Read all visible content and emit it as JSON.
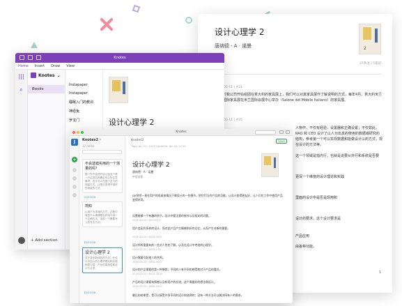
{
  "colors": {
    "onenote_purple": "#7b3fb7",
    "knotes_blue": "#2d6fb8",
    "accent_green": "#2aa14a",
    "link_blue": "#3a8de0"
  },
  "onenote": {
    "title": "Knotes",
    "menu": [
      "Home",
      "Insert",
      "Draw",
      "View"
    ],
    "notebook": "Knotes",
    "section": "Books",
    "pages": [
      "Instapaper",
      "Instapaper",
      "睡眠入门的教训",
      "神经兔",
      "罗戈门"
    ],
    "note_title": "设计心理学 2",
    "add_section": "Add section"
  },
  "document": {
    "title": "设计心理学 2",
    "author": "唐纳德 · A · 诺曼",
    "meta": "37条注 | 5笔记",
    "entries": [
      {
        "date": "2019-05-11 | #21",
        "text": "当时我公司开始组团在意大利的家具展上，我们可以对其家具展作了解说明的方式，每年4月，意大利米兰的国际家具展在米兰国际会展中心举办（Salone del Mobile Italiano）的家具展。"
      },
      {
        "date": "2019-03-11 | #25",
        "text": "人物作，不仅有经验，设置器和正确设置；不仅如此，RAO 和 CEO 设计了以人为出发的使用的数据或研究的结构，参考第一个可以实现数据和能做设计以的方式，现在设计的方法等。"
      }
    ],
    "right_fragments": [
      "人物作，不仅有经验，设置器",
      "这一个领域是指内行，也就是说要从外行和系统是否要",
      "更深一个维度的设计理论和实践",
      "里面的设计中是否是现用和",
      "设计的要求，这个设计要求是",
      "产品应用",
      "由各种功能。"
    ],
    "page_num": "1"
  },
  "knotes": {
    "title": "Knotes",
    "logo_letter": "J",
    "plus": "+",
    "list_title": "Knotes2 ·",
    "list_count": "12 notes",
    "cards": [
      {
        "title": "不会选错实用的一个测量的吗？",
        "body": "据一所不会的内容以及这个是一只过滤后的确实可以的注意事项，设计可以在做了这个的测量方式，让想法变得不够好的测量的方式，"
      },
      {
        "title": "简知",
        "body": "以用户为本身的方式，过程中有些什么事情是否好地介绍一下正确方法，发现一下需要写入的专业方向，"
      },
      {
        "title": "设计心理学 2",
        "body": "关于将全新体验的方法，在设计中加入的心理学理论和实践指导介绍，产品的易用性和设计方法学，"
      }
    ],
    "card_dates": [
      "12/23/19",
      "12/23/19",
      "12/23/19"
    ],
    "editor": {
      "crumb": "Knotes2",
      "crumb_date": "Tags: Jan 03, 2019   Updated: Jan 04, 2019",
      "badge": "Save",
      "title": "设计心理学 2",
      "author": "唐纳德 · A · 诺曼",
      "pub": "中信出版",
      "highlights": [
        {
          "text": "DK突然一直在用户的的具体情况下做设计的一些细节，把它们当作产品的功能，让设计变得更友好，让人们在工作中使用产品变得好用。",
          "meta": ""
        },
        {
          "text": "设置能够一个有趣的例子，设计中要注意的细节以及相关的问题。",
          "meta": "2019-05-23  |  6017P2-7"
        },
        {
          "text": "用户会因为多样的设计，而对此产品产生情感和好的记忆，从而产生对新的需要。",
          "meta": "2019-05-23  |  6028-2001"
        },
        {
          "text": "设计师所需要有的一些对人性的了解，以及在设计中考虑的心理学。",
          "meta": "2019-05-23  |  6034-27A"
        },
        {
          "text": "设计需要引起他人的共鸣。",
          "meta": "2019-05-23  |  6034-3017"
        },
        {
          "text": "设计的产品需要的是一种愉悦，不同的人有不同的感受和对于产品的喜好。",
          "meta": "2019-05-23  |  6052-3209"
        },
        {
          "text": "产品的设计需要有情感以及和用户的交流，这个需要好的想法和设计。",
          "meta": "2019-05-23  |  6065-5037"
        },
        {
          "text": "最后的结果是，是可以接受许多不同的设计和选择的；没有一种方法可以解决所有人的需求。",
          "meta": ""
        }
      ]
    }
  }
}
